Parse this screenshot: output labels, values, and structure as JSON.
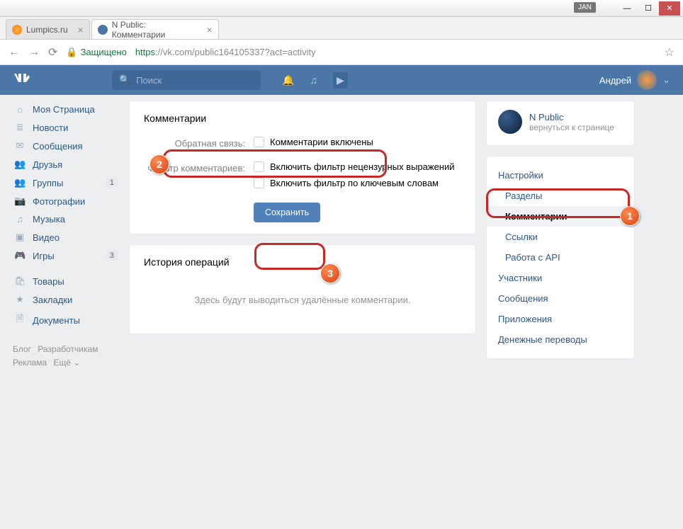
{
  "chrome": {
    "lang_badge": "JAN"
  },
  "tabs": [
    {
      "title": "Lumpics.ru",
      "active": false
    },
    {
      "title": "N Public: Комментарии",
      "active": true
    }
  ],
  "addr": {
    "secure": "Защищено",
    "proto": "https",
    "host": "://vk.com",
    "path": "/public164105337?act=activity"
  },
  "header": {
    "search_placeholder": "Поиск",
    "user": "Андрей"
  },
  "left_nav": {
    "items": [
      {
        "icon": "⌂",
        "label": "Моя Страница"
      },
      {
        "icon": "≣",
        "label": "Новости"
      },
      {
        "icon": "✉",
        "label": "Сообщения"
      },
      {
        "icon": "👥",
        "label": "Друзья"
      },
      {
        "icon": "👥",
        "label": "Группы",
        "badge": "1"
      },
      {
        "icon": "📷",
        "label": "Фотографии"
      },
      {
        "icon": "♫",
        "label": "Музыка"
      },
      {
        "icon": "▣",
        "label": "Видео"
      },
      {
        "icon": "🎮",
        "label": "Игры",
        "badge": "3"
      }
    ],
    "items2": [
      {
        "icon": "🛍",
        "label": "Товары"
      },
      {
        "icon": "★",
        "label": "Закладки"
      },
      {
        "icon": "🗎",
        "label": "Документы"
      }
    ],
    "footer": [
      "Блог",
      "Разработчикам",
      "Реклама",
      "Ещё ⌄"
    ]
  },
  "main": {
    "comments_title": "Комментарии",
    "feedback_label": "Обратная связь:",
    "feedback_opt": "Комментарии включены",
    "filter_label": "Фильтр комментариев:",
    "filter_opt1": "Включить фильтр нецензурных выражений",
    "filter_opt2": "Включить фильтр по ключевым словам",
    "save": "Сохранить",
    "history_title": "История операций",
    "history_empty": "Здесь будут выводиться удалённые комментарии."
  },
  "right": {
    "community_name": "N Public",
    "community_sub": "вернуться к странице",
    "menu": {
      "settings": "Настройки",
      "sections": "Разделы",
      "comments": "Комментарии",
      "links": "Ссылки",
      "api": "Работа с API",
      "members": "Участники",
      "messages": "Сообщения",
      "apps": "Приложения",
      "transfers": "Денежные переводы"
    }
  }
}
